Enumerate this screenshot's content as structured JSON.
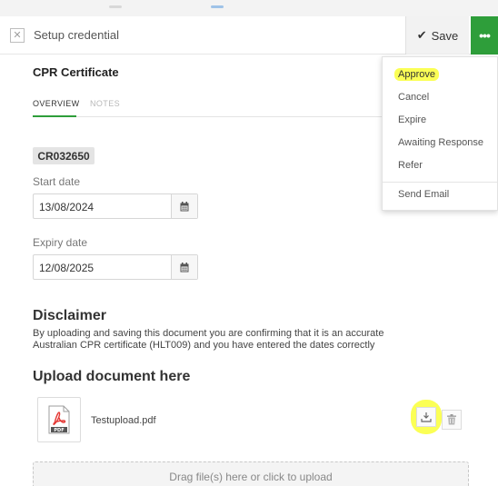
{
  "header": {
    "title": "Setup credential",
    "close_icon": "close-icon",
    "save_label": "Save",
    "save_icon": "check-icon",
    "more_icon": "ellipsis-icon",
    "more_label": "•••"
  },
  "certificate": {
    "title": "CPR Certificate",
    "tabs": [
      {
        "label": "OVERVIEW",
        "active": true
      },
      {
        "label": "NOTES",
        "active": false
      }
    ],
    "code": "CR032650"
  },
  "fields": {
    "start_date": {
      "label": "Start date",
      "value": "13/08/2024",
      "icon": "calendar-icon"
    },
    "expiry_date": {
      "label": "Expiry date",
      "value": "12/08/2025",
      "icon": "calendar-icon"
    }
  },
  "disclaimer": {
    "title": "Disclaimer",
    "line1": "By uploading and saving this document you are confirming that it is an accurate",
    "line2": "Australian CPR certificate (HLT009) and you have entered the dates correctly"
  },
  "upload": {
    "title": "Upload document here",
    "file_name": "Testupload.pdf",
    "file_badge": "PDF",
    "dropzone_text": "Drag file(s) here or click to upload"
  },
  "menu": {
    "items": [
      {
        "label": "Approve",
        "highlighted": true
      },
      {
        "label": "Cancel"
      },
      {
        "label": "Expire"
      },
      {
        "label": "Awaiting Response"
      },
      {
        "label": "Refer"
      },
      {
        "label": "Send Email"
      }
    ]
  },
  "colors": {
    "accent_green": "#2e9e3a",
    "highlight_yellow": "#fbff55",
    "pdf_red": "#e53935"
  }
}
